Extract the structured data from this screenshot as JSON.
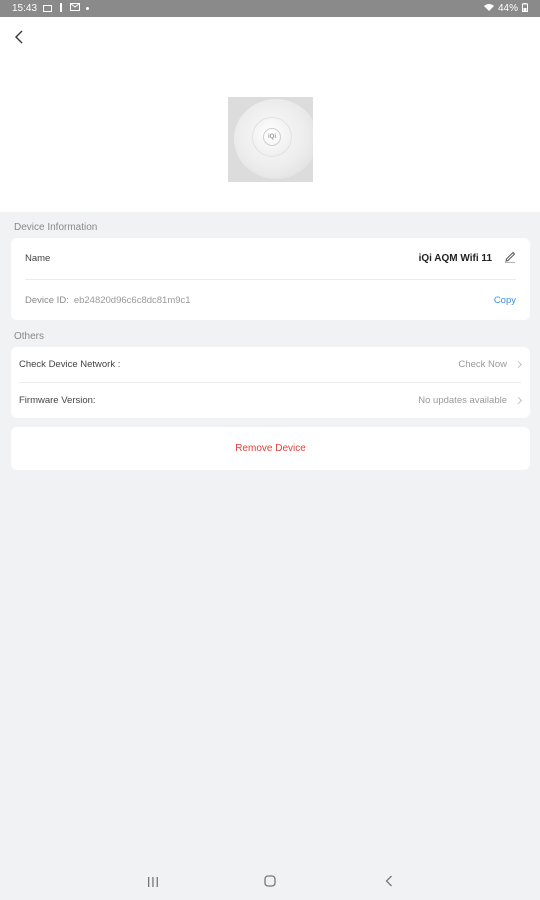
{
  "status_bar": {
    "time": "15:43",
    "battery": "44%",
    "icons": [
      "image-icon",
      "notification-icon",
      "mail-icon",
      "dot-icon",
      "wifi-icon",
      "battery-icon"
    ]
  },
  "header": {
    "back_icon": "chevron-left-icon"
  },
  "device_image": {
    "logo_text": "iQi"
  },
  "device_information": {
    "section_title": "Device Information",
    "name_label": "Name",
    "name_value": "iQi AQM Wifi 11",
    "device_id_label": "Device ID:",
    "device_id_value": "eb24820d96c6c8dc81m9c1",
    "copy_label": "Copy"
  },
  "others": {
    "section_title": "Others",
    "network_label": "Check Device Network :",
    "network_action": "Check Now",
    "firmware_label": "Firmware Version:",
    "firmware_value": "No updates available"
  },
  "remove": {
    "label": "Remove Device"
  },
  "colors": {
    "background": "#f1f2f4",
    "card": "#ffffff",
    "link": "#3d8fe0",
    "danger": "#e0403c",
    "status_bar": "#8a8a8a"
  },
  "nav_bar": {
    "items": [
      "recent-apps-icon",
      "home-icon",
      "back-icon"
    ]
  }
}
